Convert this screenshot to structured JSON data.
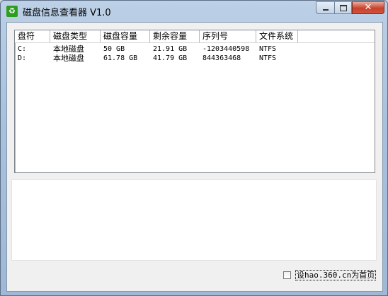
{
  "window": {
    "title": "磁盘信息查看器 V1.0",
    "icon": "recycle-icon",
    "controls": {
      "minimize_icon": "minimize-icon",
      "maximize_icon": "maximize-icon",
      "close_glyph": "✕"
    }
  },
  "table": {
    "columns": [
      "盘符",
      "磁盘类型",
      "磁盘容量",
      "剩余容量",
      "序列号",
      "文件系统"
    ],
    "rows": [
      {
        "drive": "C:",
        "type": "本地磁盘",
        "capacity": "50 GB",
        "free": "21.91 GB",
        "serial": "-1203440598",
        "fs": "NTFS"
      },
      {
        "drive": "D:",
        "type": "本地磁盘",
        "capacity": "61.78 GB",
        "free": "41.79 GB",
        "serial": "844363468",
        "fs": "NTFS"
      }
    ]
  },
  "homepage_option": {
    "label": "设hao.360.cn为首页",
    "checked": false
  },
  "colors": {
    "title_bar": "#a9c1dc",
    "close_button": "#c8412b",
    "app_icon": "#2f9e1f"
  }
}
